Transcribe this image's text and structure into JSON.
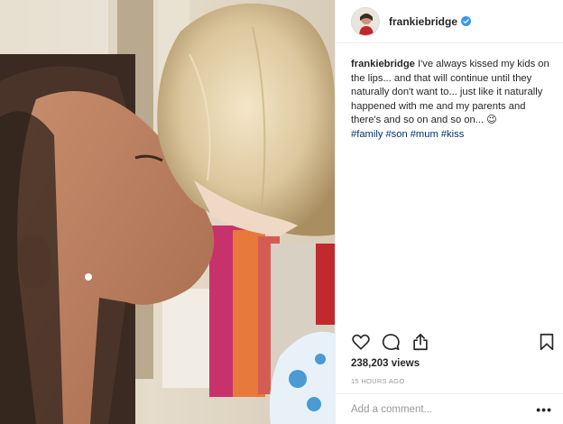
{
  "post": {
    "username": "frankiebridge",
    "verified_icon": "verified-badge-icon",
    "caption": {
      "username": "frankiebridge",
      "text": "I've always kissed my kids on the lips... and that will continue until they naturally don't want to... just like it naturally happened with me and my parents and there's and so on and so on... 😉",
      "hashtags": [
        "#family",
        "#son",
        "#mum",
        "#kiss"
      ]
    },
    "views": "238,203 views",
    "time_ago": "15 HOURS AGO",
    "comment_placeholder": "Add a comment...",
    "more_label": "•••"
  },
  "icons": {
    "like": "heart-icon",
    "comment": "comment-bubble-icon",
    "share": "share-icon",
    "save": "bookmark-icon"
  },
  "colors": {
    "hashtag": "#003569",
    "verified": "#3897f0",
    "meta_gray": "#999999",
    "text": "#262626"
  }
}
